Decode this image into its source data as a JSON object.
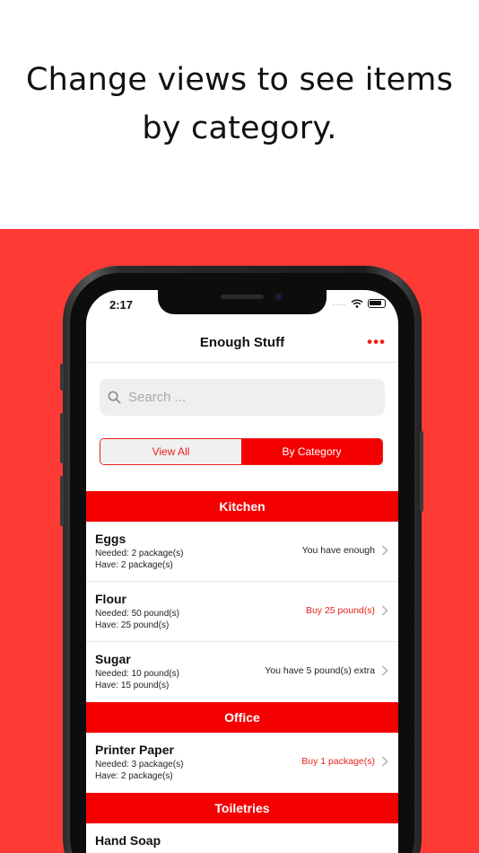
{
  "headline": {
    "line1": "Change views to see items",
    "line2": "by category."
  },
  "status_bar": {
    "time": "2:17",
    "signal": "....",
    "wifi_icon": "wifi-icon",
    "battery_icon": "battery-icon"
  },
  "nav": {
    "title": "Enough Stuff",
    "more_label": "•••",
    "more_icon": "more-dots-icon"
  },
  "search": {
    "placeholder": "Search ...",
    "icon": "search-icon"
  },
  "segments": {
    "view_all": "View All",
    "by_category": "By Category",
    "selected": "By Category"
  },
  "sections": [
    {
      "title": "Kitchen",
      "items": [
        {
          "name": "Eggs",
          "needed": "Needed: 2 package(s)",
          "have": "Have: 2 package(s)",
          "status": "You have enough",
          "alert": false
        },
        {
          "name": "Flour",
          "needed": "Needed: 50 pound(s)",
          "have": "Have: 25 pound(s)",
          "status": "Buy 25 pound(s)",
          "alert": true
        },
        {
          "name": "Sugar",
          "needed": "Needed: 10 pound(s)",
          "have": "Have: 15 pound(s)",
          "status": "You have 5 pound(s) extra",
          "alert": false
        }
      ]
    },
    {
      "title": "Office",
      "items": [
        {
          "name": "Printer Paper",
          "needed": "Needed: 3 package(s)",
          "have": "Have: 2 package(s)",
          "status": "Buy 1 package(s)",
          "alert": true
        }
      ]
    },
    {
      "title": "Toiletries",
      "items": [
        {
          "name": "Hand Soap",
          "needed": "",
          "have": "",
          "status": "",
          "alert": false
        }
      ]
    }
  ],
  "colors": {
    "band": "#fd3a34",
    "accent": "#f40000",
    "alert_text": "#e8211b"
  }
}
